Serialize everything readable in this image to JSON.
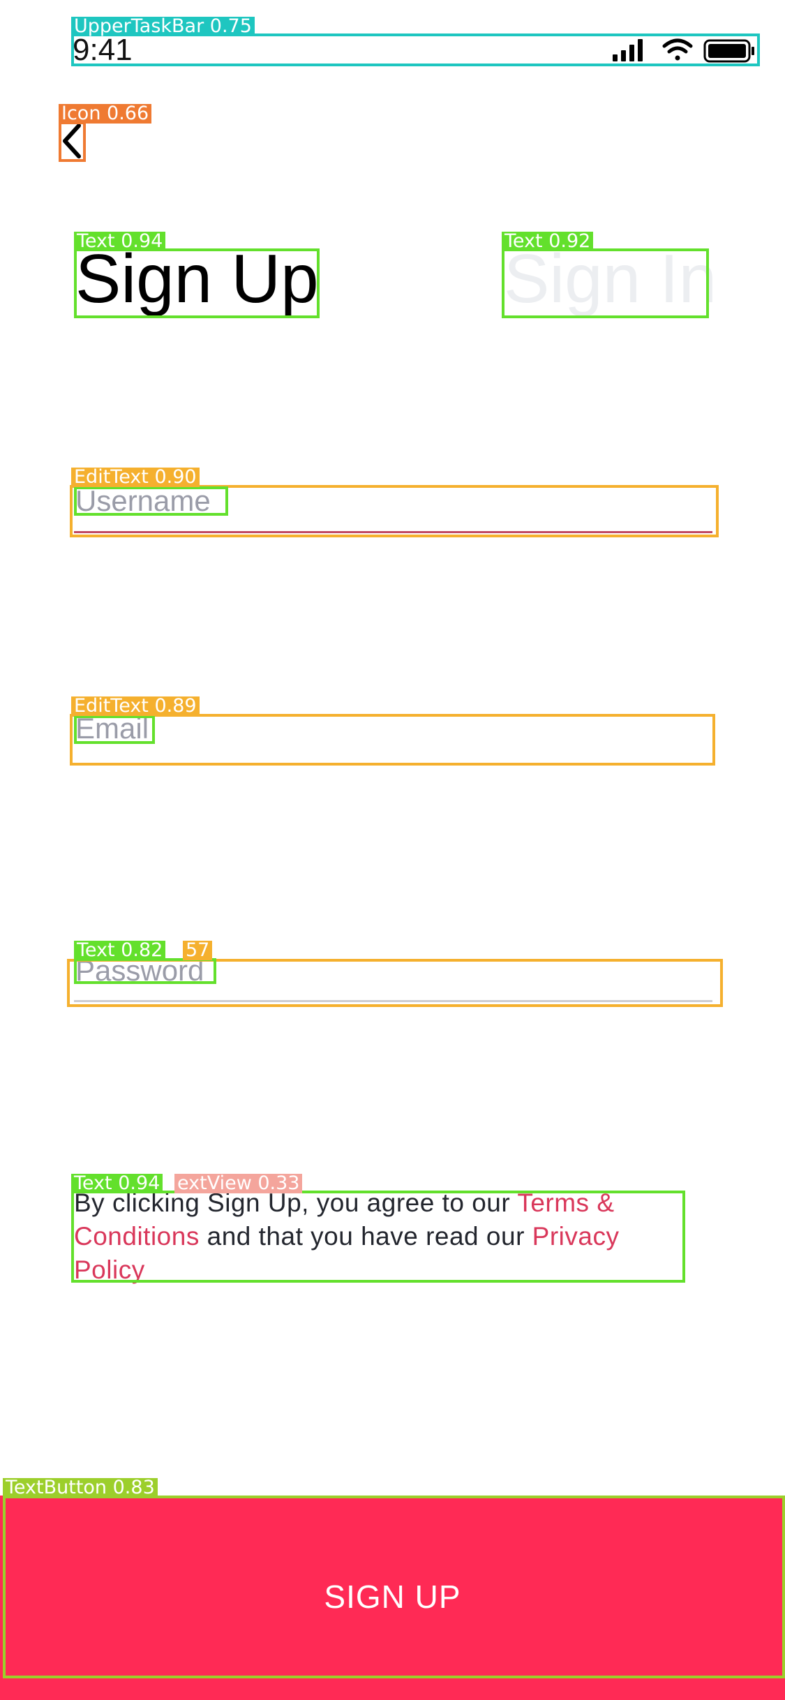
{
  "status_bar": {
    "time": "9:41"
  },
  "header": {
    "back_icon": "chevron-left-icon"
  },
  "tabs": {
    "sign_up": "Sign Up",
    "sign_in": "Sign In"
  },
  "form": {
    "username_placeholder": "Username",
    "email_placeholder": "Email",
    "password_placeholder": "Password"
  },
  "terms": {
    "prefix": "By clicking Sign Up, you agree to our ",
    "terms_link": "Terms & Conditions",
    "middle": " and that you have read our ",
    "privacy_link": "Privacy Policy"
  },
  "actions": {
    "signup_button": "SIGN UP"
  },
  "annotations": {
    "upper_task_bar": "UpperTaskBar 0.75",
    "icon": "Icon 0.66",
    "text_sign_up": "Text 0.94",
    "text_sign_in": "Text 0.92",
    "edittext_username": "EditText 0.90",
    "edittext_email": "EditText 0.89",
    "text_password": "Text 0.82",
    "password_fragment": "57",
    "text_terms": "Text 0.94",
    "textview_terms": "extView 0.33",
    "text_button": "TextButton 0.83"
  },
  "colors": {
    "accent": "#ff2a55",
    "link": "#d9375a",
    "underline_active": "#c14a64",
    "annotation_cyan": "#1ec6c0",
    "annotation_orange": "#ef7a32",
    "annotation_green": "#63e02c",
    "annotation_amber": "#f5b02e",
    "annotation_olive": "#9ccf2b"
  }
}
